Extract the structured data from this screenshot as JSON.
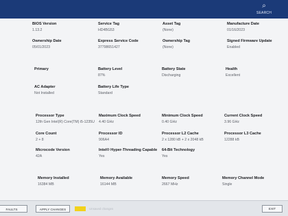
{
  "header": {
    "search_label": "SEARCH",
    "search_icon": "search-icon"
  },
  "overview": {
    "bios_version": {
      "label": "BIOS Version",
      "value": "1.13.2"
    },
    "service_tag": {
      "label": "Service Tag",
      "value": "HD4BG53"
    },
    "asset_tag": {
      "label": "Asset Tag",
      "value": "(None)"
    },
    "manufacture_date": {
      "label": "Manufacture Date",
      "value": "01/16/2023"
    },
    "ownership_date": {
      "label": "Ownership Date",
      "value": "05/01/2023"
    },
    "express_service_code": {
      "label": "Express Service Code",
      "value": "37798651427"
    },
    "ownership_tag": {
      "label": "Ownership Tag",
      "value": "(None)"
    },
    "signed_firmware_update": {
      "label": "Signed Firmware Update",
      "value": "Enabled"
    }
  },
  "battery": {
    "primary": {
      "label": "Primary",
      "value": ""
    },
    "battery_level": {
      "label": "Battery Level",
      "value": "87%"
    },
    "battery_state": {
      "label": "Battery State",
      "value": "Discharging"
    },
    "health": {
      "label": "Health",
      "value": "Excellent"
    },
    "ac_adapter": {
      "label": "AC Adapter",
      "value": "Not Installed"
    },
    "battery_life_type": {
      "label": "Battery Life Type",
      "value": "Standard"
    }
  },
  "processor": {
    "processor_type": {
      "label": "Processor Type",
      "value": "12th Gen Intel(R) Core(TM) i5-1235U"
    },
    "max_clock_speed": {
      "label": "Maximum Clock Speed",
      "value": "4.40 GHz"
    },
    "min_clock_speed": {
      "label": "Minimum Clock Speed",
      "value": "0.40 GHz"
    },
    "current_clock_speed": {
      "label": "Current Clock Speed",
      "value": "3.96 GHz"
    },
    "core_count": {
      "label": "Core Count",
      "value": "2 + 8"
    },
    "processor_id": {
      "label": "Processor ID",
      "value": "906A4"
    },
    "l2_cache": {
      "label": "Processor L2 Cache",
      "value": "2 x 1280 kB + 2 x 2048 kB"
    },
    "l3_cache": {
      "label": "Processor L3 Cache",
      "value": "12288 kB"
    },
    "microcode_version": {
      "label": "Microcode Version",
      "value": "42A"
    },
    "hyper_threading": {
      "label": "Intel® Hyper-Threading Capable",
      "value": "Yes"
    },
    "x64_technology": {
      "label": "64-Bit Technology",
      "value": "Yes"
    }
  },
  "memory": {
    "memory_installed": {
      "label": "Memory Installed",
      "value": "16384 MB"
    },
    "memory_available": {
      "label": "Memory Available",
      "value": "16144 MB"
    },
    "memory_speed": {
      "label": "Memory Speed",
      "value": "2667 MHz"
    },
    "memory_channel_mode": {
      "label": "Memory Channel Mode",
      "value": "Single"
    }
  },
  "footer": {
    "defaults_label": "FAULTS",
    "apply_changes_label": "APPLY CHANGES",
    "faded_text": "Unsaved changes",
    "exit_label": "EXIT",
    "indicator_color": "#f2d21b",
    "topbar_color": "#1b3a78"
  }
}
